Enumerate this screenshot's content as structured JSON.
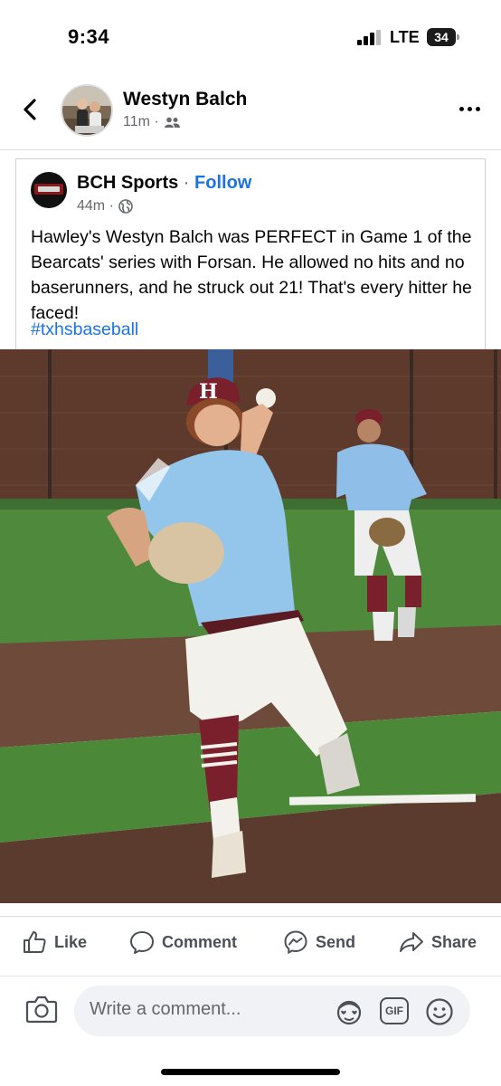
{
  "status_bar": {
    "time": "9:34",
    "network": "LTE",
    "battery": "34"
  },
  "header": {
    "name": "Westyn Balch",
    "time": "11m ·",
    "audience_icon": "friends-icon"
  },
  "shared_post": {
    "page_name": "BCH Sports",
    "separator": " · ",
    "follow_label": "Follow",
    "time": "44m ·",
    "audience_icon": "globe-icon",
    "text": "Hawley's Westyn Balch was PERFECT in Game 1 of the Bearcats' series with Forsan. He allowed no hits and no baserunners, and he struck out 21! That's every hitter he faced!",
    "hashtag": "#txhsbaseball"
  },
  "actions": {
    "like": "Like",
    "comment": "Comment",
    "send": "Send",
    "share": "Share"
  },
  "comment_bar": {
    "placeholder": "Write a comment...",
    "gif_label": "GIF"
  },
  "colors": {
    "link_blue": "#1b74e4",
    "secondary_text": "#65676b",
    "action_gray": "#4b4f56"
  }
}
